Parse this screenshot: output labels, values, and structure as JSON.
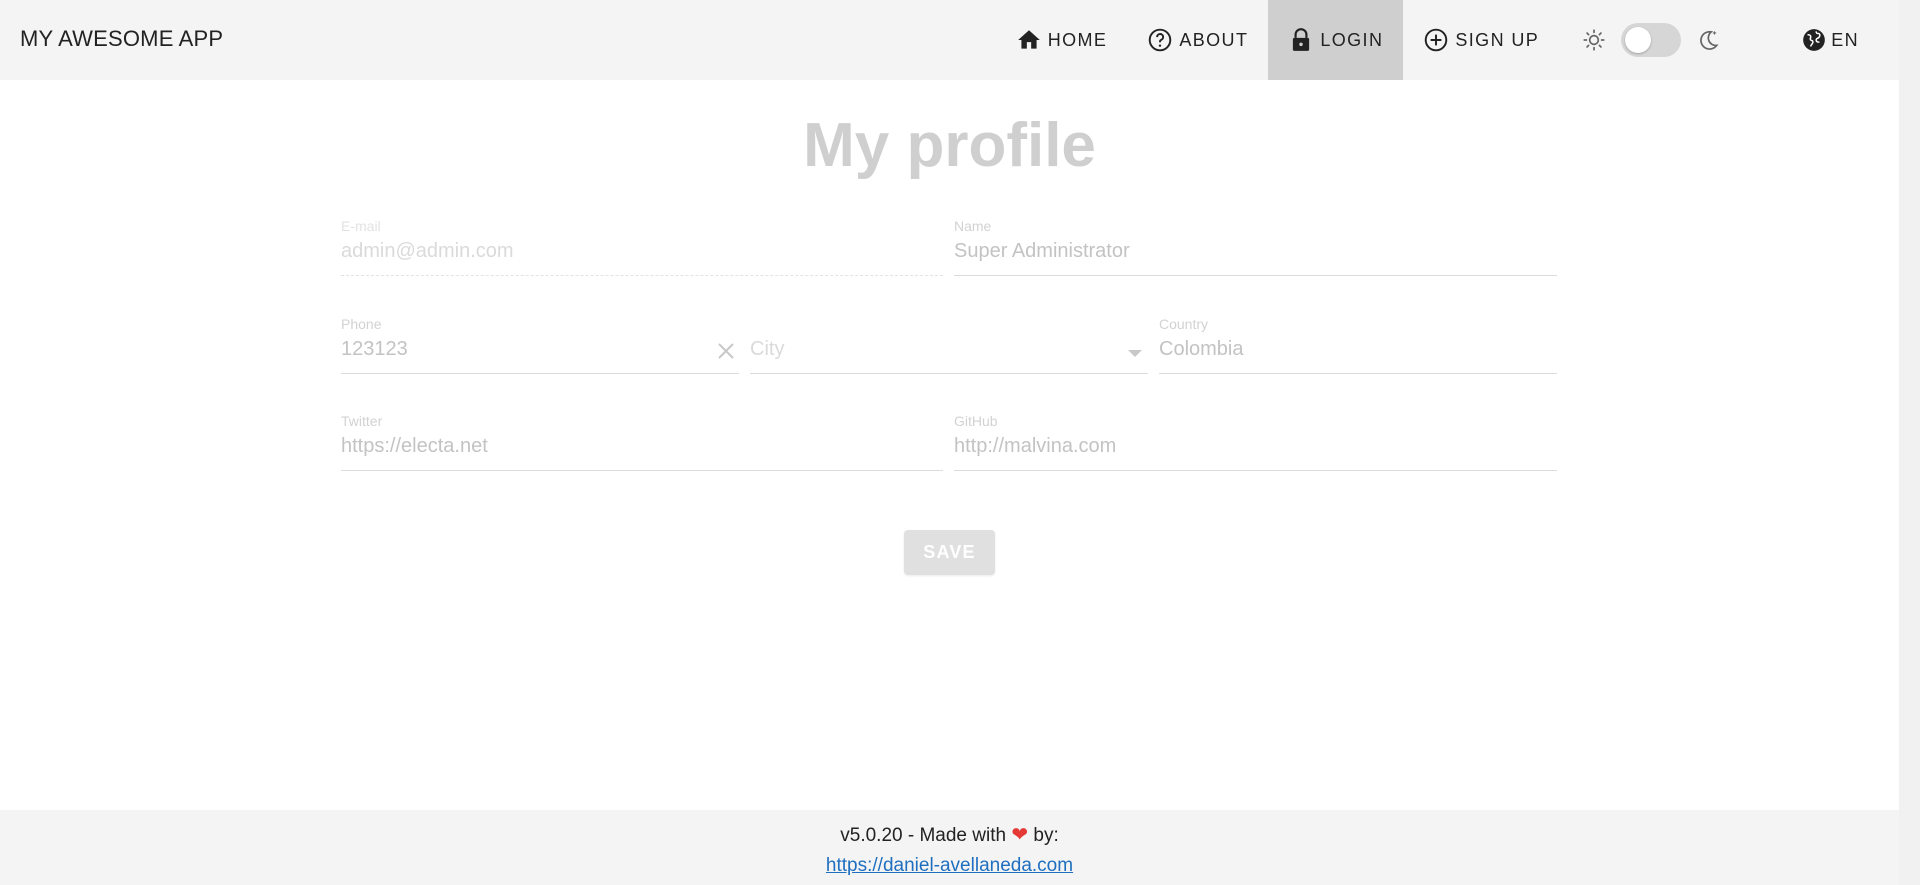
{
  "app": {
    "title": "MY AWESOME APP"
  },
  "nav": {
    "items": [
      {
        "label": "HOME",
        "icon": "home-icon"
      },
      {
        "label": "ABOUT",
        "icon": "help-circle-icon"
      },
      {
        "label": "LOGIN",
        "icon": "lock-icon",
        "active": true
      },
      {
        "label": "SIGN UP",
        "icon": "plus-circle-icon"
      }
    ],
    "theme": {
      "light_icon": "sun-icon",
      "dark_icon": "moon-icon",
      "dark_mode": false
    },
    "language": {
      "label": "EN",
      "icon": "globe-icon"
    }
  },
  "page": {
    "title": "My profile"
  },
  "form": {
    "email": {
      "label": "E-mail",
      "value": "admin@admin.com",
      "disabled": true
    },
    "name": {
      "label": "Name",
      "value": "Super Administrator"
    },
    "phone": {
      "label": "Phone",
      "value": "123123"
    },
    "city": {
      "placeholder": "City",
      "value": ""
    },
    "country": {
      "label": "Country",
      "value": "Colombia"
    },
    "twitter": {
      "label": "Twitter",
      "value": "https://electa.net"
    },
    "github": {
      "label": "GitHub",
      "value": "http://malvina.com"
    },
    "save_label": "SAVE"
  },
  "footer": {
    "text_before": "v5.0.20 - Made with",
    "text_after": "by:",
    "link": "https://daniel-avellaneda.com"
  },
  "colors": {
    "header_bg": "#f4f4f4",
    "active_nav_bg": "#cfcfcf",
    "heart": "#e53935",
    "link": "#1f6fc0"
  }
}
